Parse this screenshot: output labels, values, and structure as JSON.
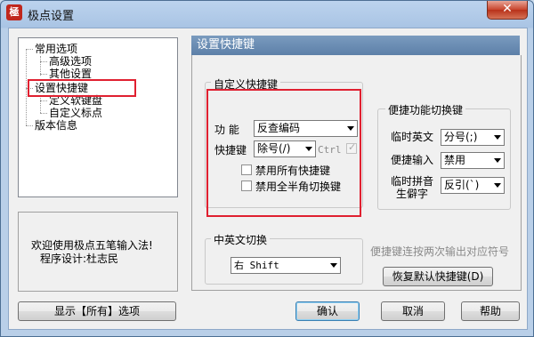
{
  "window": {
    "title": "极点设置",
    "app_icon_glyph": "極",
    "close_glyph": "✕"
  },
  "tree": {
    "items": [
      {
        "label": "常用选项"
      },
      {
        "label": "高级选项"
      },
      {
        "label": "其他设置"
      },
      {
        "label": "设置快捷键"
      },
      {
        "label": "定义软键盘"
      },
      {
        "label": "自定义标点"
      },
      {
        "label": "版本信息"
      }
    ],
    "selected": "设置快捷键"
  },
  "info": {
    "line1": "欢迎使用极点五笔输入法!",
    "line2": "程序设计:杜志民"
  },
  "panel": {
    "title": "设置快捷键",
    "custom": {
      "title": "自定义快捷键",
      "function_label": "功  能",
      "function_value": "反查编码",
      "hotkey_label": "快捷键",
      "hotkey_value": "除号(/)",
      "ctrl_label": "Ctrl",
      "ctrl_checked": true,
      "disable_all_label": "禁用所有快捷键",
      "disable_all_checked": false,
      "disable_fullhalf_label": "禁用全半角切换键",
      "disable_fullhalf_checked": false
    },
    "quick": {
      "title": "便捷功能切换键",
      "temp_en_label": "临时英文",
      "temp_en_value": "分号(;)",
      "quick_input_label": "便捷输入",
      "quick_input_value": "禁用",
      "pinyin_label_line1": "临时拼音",
      "pinyin_label_line2": "生僻字",
      "pinyin_value": "反引(`)"
    },
    "cn_en": {
      "title": "中英文切换",
      "value": "右 Shift"
    },
    "double_press_hint": "便捷键连按两次输出对应符号",
    "restore_button": "恢复默认快捷键(D)"
  },
  "footer": {
    "show_all_button": "显示【所有】选项",
    "ok_button": "确认",
    "cancel_button": "取消",
    "help_button": "帮助"
  },
  "colors": {
    "highlight_red": "#e02030",
    "header_blue": "#5d80a8"
  }
}
